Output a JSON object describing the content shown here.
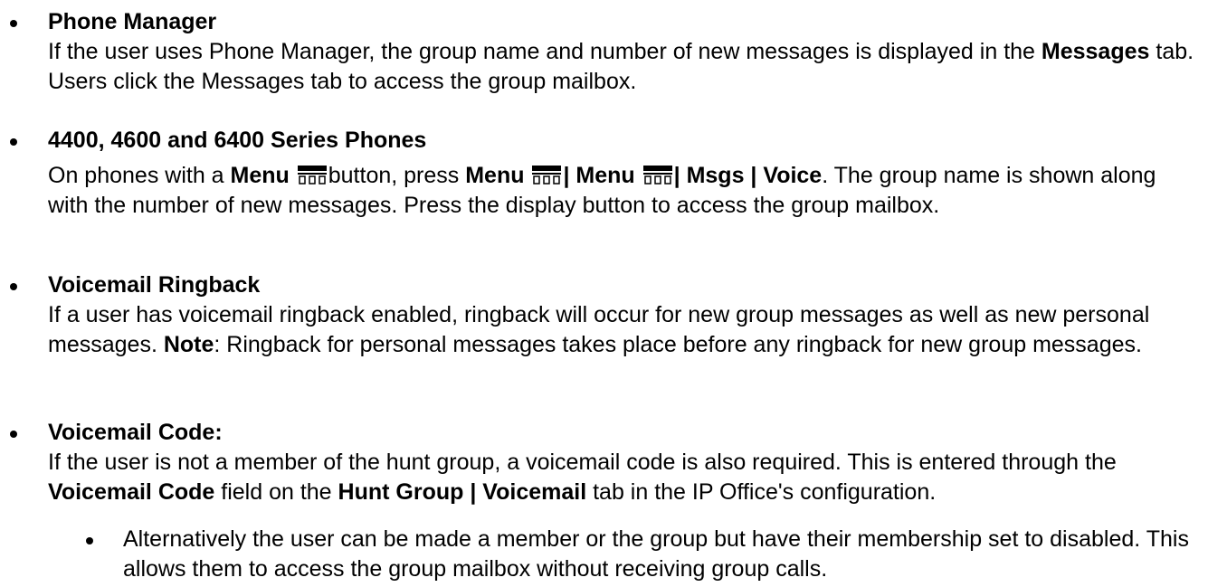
{
  "items": [
    {
      "heading": "Phone Manager",
      "p1": "If the user uses Phone Manager, the group name and number of new messages is displayed in the ",
      "b1": "Messages",
      "p2": " tab. Users click the Messages tab to access the group mailbox."
    },
    {
      "heading": "4400, 4600 and 6400 Series Phones",
      "p1": "On phones with a ",
      "b1": "Menu",
      "p2": "button, press ",
      "b2": "Menu",
      "sep1": "| Menu",
      "sep2": "| Msgs | Voice",
      "p3": ". The group name is shown along with the number of new messages. Press the display button to access the group mailbox."
    },
    {
      "heading": "Voicemail Ringback",
      "p1": "If a user has voicemail ringback enabled, ringback will occur for new group messages as well as new personal messages. ",
      "b1": "Note",
      "p2": ": Ringback for personal messages takes place before any ringback for new group messages."
    },
    {
      "heading": "Voicemail Code:",
      "p1": "If the user is not a member of the hunt group, a voicemail code is also required. This is entered through the ",
      "b1": "Voicemail Code",
      "p2": " field on the ",
      "b2": "Hunt Group | Voicemail",
      "p3": " tab in the IP Office's configuration."
    }
  ],
  "subitem": {
    "text": "Alternatively the user can be made a member or the group but have their membership set to disabled. This allows them to access the group mailbox without receiving group calls."
  },
  "icons": {
    "menu": "menu-button-icon"
  }
}
